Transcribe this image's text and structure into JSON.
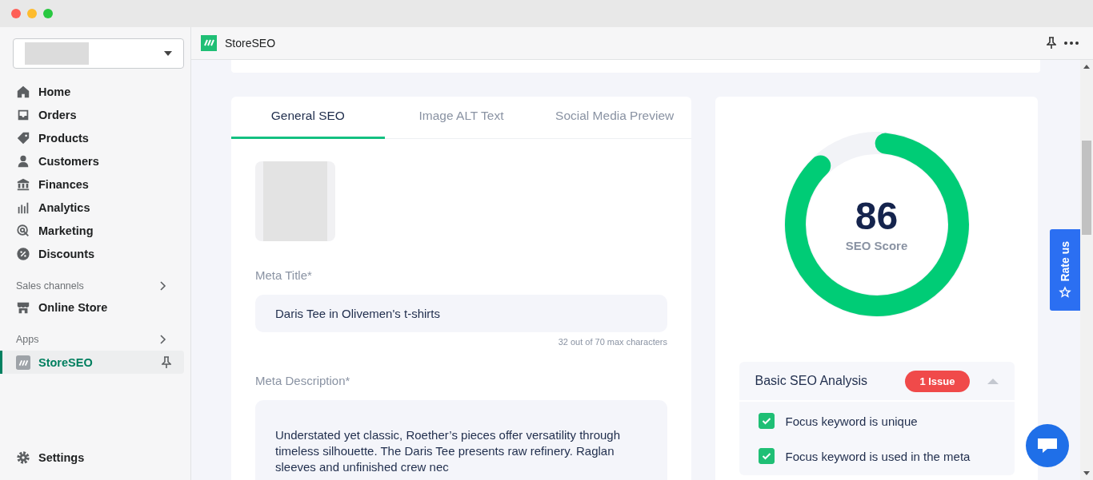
{
  "sidebar": {
    "nav_items": [
      {
        "label": "Home",
        "kind": "home"
      },
      {
        "label": "Orders",
        "kind": "inbox"
      },
      {
        "label": "Products",
        "kind": "tag"
      },
      {
        "label": "Customers",
        "kind": "person"
      },
      {
        "label": "Finances",
        "kind": "bank"
      },
      {
        "label": "Analytics",
        "kind": "bars"
      },
      {
        "label": "Marketing",
        "kind": "target"
      },
      {
        "label": "Discounts",
        "kind": "discount"
      }
    ],
    "sections": [
      {
        "title": "Sales channels",
        "items": [
          {
            "label": "Online Store",
            "kind": "store",
            "selected": false
          }
        ]
      },
      {
        "title": "Apps",
        "items": [
          {
            "label": "StoreSEO",
            "kind": "app",
            "selected": true
          }
        ]
      }
    ],
    "settings": "Settings"
  },
  "app_header": {
    "title": "StoreSEO"
  },
  "tabs": [
    {
      "label": "General SEO",
      "selected": true
    },
    {
      "label": "Image ALT Text",
      "selected": false
    },
    {
      "label": "Social Media Preview",
      "selected": false
    }
  ],
  "meta_title": {
    "label": "Meta Title*",
    "value": "Daris Tee in Olivemen's t-shirts",
    "counter": "32 out of 70 max characters"
  },
  "meta_description": {
    "label": "Meta Description*",
    "value": "Understated yet classic, Roether’s pieces offer versatility through timeless silhouette. The Daris Tee presents raw refinery. Raglan sleeves and unfinished crew nec"
  },
  "score": {
    "value": "86",
    "label": "SEO Score",
    "level": 0.86
  },
  "analysis": {
    "title": "Basic SEO Analysis",
    "badge": "1 Issue",
    "expanded": true,
    "items": [
      {
        "label": "Focus keyword is unique",
        "checked": true
      },
      {
        "label": "Focus keyword is used in the meta",
        "checked": true
      }
    ]
  },
  "rate_us": "Rate us"
}
